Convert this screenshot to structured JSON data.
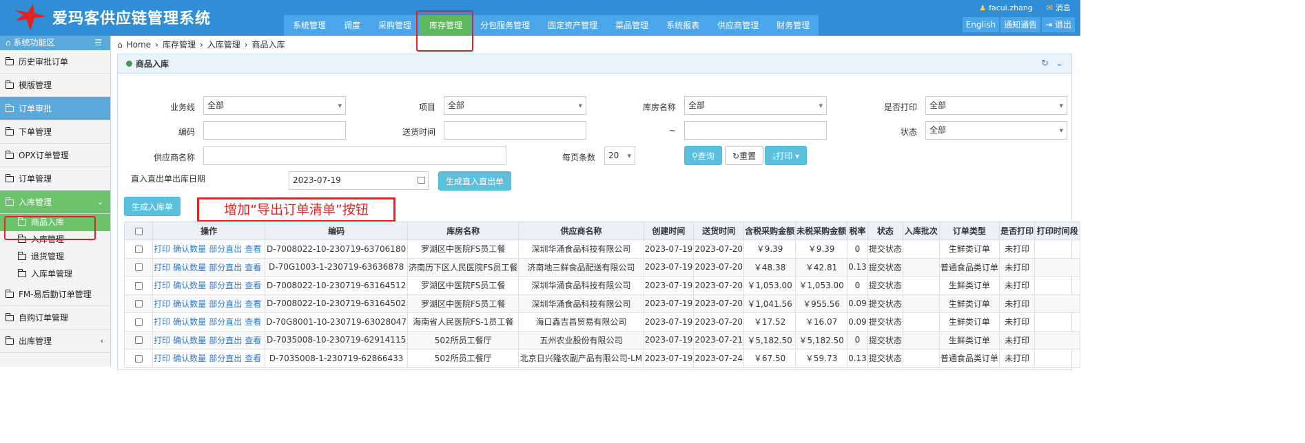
{
  "app": {
    "title": "爱玛客供应链管理系统",
    "user": "facui.zhang",
    "messages": "消息"
  },
  "topnav": [
    "系统管理",
    "调度",
    "采购管理",
    "库存管理",
    "分包服务管理",
    "固定资产管理",
    "菜品管理",
    "系统报表",
    "供应商管理",
    "财务管理"
  ],
  "topnav_active": "库存管理",
  "top_buttons": {
    "english": "English",
    "notice": "通知通告",
    "logout": "退出"
  },
  "sidebar": {
    "title": "系统功能区",
    "items": [
      "历史审批订单",
      "模版管理",
      "订单审批",
      "下单管理",
      "OPX订单管理",
      "订单管理",
      "入库管理"
    ],
    "subitems": [
      "商品入库",
      "入库管理",
      "退货管理",
      "入库单管理"
    ],
    "items_after": [
      "FM-易后勤订单管理",
      "自购订单管理",
      "出库管理"
    ]
  },
  "breadcrumb": [
    "Home",
    "库存管理",
    "入库管理",
    "商品入库"
  ],
  "panel_title": "商品入库",
  "filters": {
    "business_line": {
      "label": "业务线",
      "value": "全部"
    },
    "project": {
      "label": "项目",
      "value": "全部"
    },
    "warehouse": {
      "label": "库房名称",
      "value": "全部"
    },
    "printed": {
      "label": "是否打印",
      "value": "全部"
    },
    "code": {
      "label": "编码",
      "value": ""
    },
    "delivery_time": {
      "label": "送货时间",
      "value": ""
    },
    "range_sep": "~",
    "delivery_time_end": "",
    "status": {
      "label": "状态",
      "value": "全部"
    },
    "supplier": {
      "label": "供应商名称",
      "value": ""
    },
    "page_size": {
      "label": "每页条数",
      "value": "20"
    },
    "direct_date": {
      "label": "直入直出单出库日期",
      "value": "2023-07-19"
    }
  },
  "buttons": {
    "query": "查询",
    "reset": "重置",
    "print": "打印",
    "gen_direct": "生成直入直出单",
    "gen_inbound": "生成入库单"
  },
  "annotation": "增加“导出订单清单”按钮",
  "table": {
    "columns": [
      "",
      "操作",
      "编码",
      "库房名称",
      "供应商名称",
      "创建时间",
      "送货时间",
      "含税采购金额",
      "未税采购金额",
      "税率",
      "状态",
      "入库批次",
      "订单类型",
      "是否打印",
      "打印时间段"
    ],
    "ops": [
      "打印",
      "确认数量",
      "部分直出",
      "查看"
    ],
    "rows": [
      [
        "D-7008022-10-230719-63706180",
        "罗湖区中医院FS员工餐",
        "深圳华涌食品科技有限公司",
        "2023-07-19",
        "2023-07-20",
        "￥9.39",
        "￥9.39",
        "0",
        "提交状态",
        "",
        "生鲜类订单",
        "未打印",
        ""
      ],
      [
        "D-70G1003-1-230719-63636878",
        "济南历下区人民医院FS员工餐",
        "济南地三鲜食品配送有限公司",
        "2023-07-19",
        "2023-07-20",
        "￥48.38",
        "￥42.81",
        "0.13",
        "提交状态",
        "",
        "普通食品类订单",
        "未打印",
        ""
      ],
      [
        "D-7008022-10-230719-63164512",
        "罗湖区中医院FS员工餐",
        "深圳华涌食品科技有限公司",
        "2023-07-19",
        "2023-07-20",
        "￥1,053.00",
        "￥1,053.00",
        "0",
        "提交状态",
        "",
        "生鲜类订单",
        "未打印",
        ""
      ],
      [
        "D-7008022-10-230719-63164502",
        "罗湖区中医院FS员工餐",
        "深圳华涌食品科技有限公司",
        "2023-07-19",
        "2023-07-20",
        "￥1,041.56",
        "￥955.56",
        "0.09",
        "提交状态",
        "",
        "生鲜类订单",
        "未打印",
        ""
      ],
      [
        "D-70G8001-10-230719-63028047",
        "海南省人民医院FS-1员工餐",
        "海口鑫吉昌贸易有限公司",
        "2023-07-19",
        "2023-07-20",
        "￥17.52",
        "￥16.07",
        "0.09",
        "提交状态",
        "",
        "生鲜类订单",
        "未打印",
        ""
      ],
      [
        "D-7035008-10-230719-62914115",
        "502所员工餐厅",
        "五州农业股份有限公司",
        "2023-07-19",
        "2023-07-21",
        "￥5,182.50",
        "￥5,182.50",
        "0",
        "提交状态",
        "",
        "生鲜类订单",
        "未打印",
        ""
      ],
      [
        "D-7035008-1-230719-62866433",
        "502所员工餐厅",
        "北京日兴隆农副产品有限公司-LM",
        "2023-07-19",
        "2023-07-24",
        "￥67.50",
        "￥59.73",
        "0.13",
        "提交状态",
        "",
        "普通食品类订单",
        "未打印",
        ""
      ]
    ]
  },
  "colors": {
    "header": "#2f8ed6",
    "nav": "#4aa6e8",
    "active": "#5cb85c",
    "annotation": "#e32121",
    "info_button": "#5bc0de"
  }
}
